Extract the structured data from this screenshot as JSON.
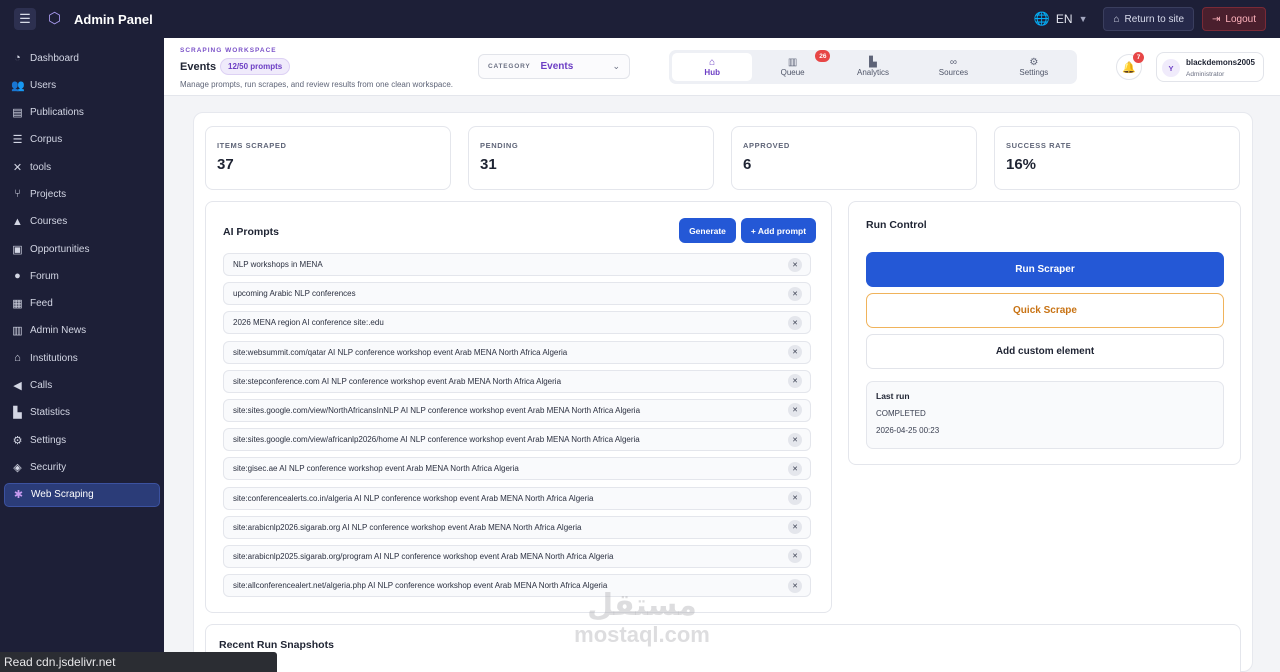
{
  "topbar": {
    "app_title": "Admin Panel",
    "language": "EN",
    "return_label": "Return to site",
    "logout_label": "Logout"
  },
  "sidebar": {
    "items": [
      {
        "label": "Dashboard",
        "icon": "gauge-icon"
      },
      {
        "label": "Users",
        "icon": "users-icon"
      },
      {
        "label": "Publications",
        "icon": "book-icon"
      },
      {
        "label": "Corpus",
        "icon": "database-icon"
      },
      {
        "label": "tools",
        "icon": "tools-icon"
      },
      {
        "label": "Projects",
        "icon": "project-icon"
      },
      {
        "label": "Courses",
        "icon": "graduation-icon"
      },
      {
        "label": "Opportunities",
        "icon": "briefcase-icon"
      },
      {
        "label": "Forum",
        "icon": "comments-icon"
      },
      {
        "label": "Feed",
        "icon": "feed-icon"
      },
      {
        "label": "Admin News",
        "icon": "news-icon"
      },
      {
        "label": "Institutions",
        "icon": "institution-icon"
      },
      {
        "label": "Calls",
        "icon": "megaphone-icon"
      },
      {
        "label": "Statistics",
        "icon": "chart-icon"
      },
      {
        "label": "Settings",
        "icon": "gear-icon"
      },
      {
        "label": "Security",
        "icon": "shield-icon"
      },
      {
        "label": "Web Scraping",
        "icon": "spider-icon",
        "active": true
      }
    ]
  },
  "header": {
    "eyebrow": "SCRAPING WORKSPACE",
    "title": "Events",
    "quota": "12/50 prompts",
    "description": "Manage prompts, run scrapes, and review results from one clean workspace.",
    "category_label": "CATEGORY",
    "category_value": "Events",
    "tabs": [
      {
        "label": "Hub",
        "icon": "home-icon",
        "active": true
      },
      {
        "label": "Queue",
        "icon": "trash-icon",
        "badge": "26"
      },
      {
        "label": "Analytics",
        "icon": "chart-icon"
      },
      {
        "label": "Sources",
        "icon": "link-icon"
      },
      {
        "label": "Settings",
        "icon": "gear-icon"
      }
    ],
    "notifications": "7",
    "user": {
      "initial": "Y",
      "name": "blackdemons2005",
      "role": "Administrator"
    }
  },
  "stats": [
    {
      "label": "ITEMS SCRAPED",
      "value": "37"
    },
    {
      "label": "PENDING",
      "value": "31"
    },
    {
      "label": "APPROVED",
      "value": "6"
    },
    {
      "label": "SUCCESS RATE",
      "value": "16%"
    }
  ],
  "prompts": {
    "title": "AI Prompts",
    "generate_label": "Generate",
    "add_label": "+ Add prompt",
    "items": [
      "NLP workshops in MENA",
      "upcoming Arabic NLP conferences",
      "2026 MENA region AI conference site:.edu",
      "site:websummit.com/qatar AI NLP conference workshop event Arab MENA North Africa Algeria",
      "site:stepconference.com AI NLP conference workshop event Arab MENA North Africa Algeria",
      "site:sites.google.com/view/NorthAfricansInNLP AI NLP conference workshop event Arab MENA North Africa Algeria",
      "site:sites.google.com/view/africanlp2026/home AI NLP conference workshop event Arab MENA North Africa Algeria",
      "site:gisec.ae AI NLP conference workshop event Arab MENA North Africa Algeria",
      "site:conferencealerts.co.in/algeria AI NLP conference workshop event Arab MENA North Africa Algeria",
      "site:arabicnlp2026.sigarab.org AI NLP conference workshop event Arab MENA North Africa Algeria",
      "site:arabicnlp2025.sigarab.org/program AI NLP conference workshop event Arab MENA North Africa Algeria",
      "site:allconferencealert.net/algeria.php AI NLP conference workshop event Arab MENA North Africa Algeria"
    ]
  },
  "run_control": {
    "title": "Run Control",
    "run_label": "Run Scraper",
    "quick_label": "Quick Scrape",
    "custom_label": "Add custom element",
    "last_run_title": "Last run",
    "last_run_status": "COMPLETED",
    "last_run_time": "2026-04-25 00:23"
  },
  "snapshots": {
    "title": "Recent Run Snapshots"
  },
  "watermark": {
    "arabic": "مستقل",
    "latin": "mostaql.com"
  },
  "status_bar": "Read cdn.jsdelivr.net",
  "colors": {
    "accent": "#2458d6",
    "brand_purple": "#6c3ec4",
    "sidebar_bg": "#1d1f37",
    "warning": "#c87314",
    "danger": "#e74646"
  }
}
